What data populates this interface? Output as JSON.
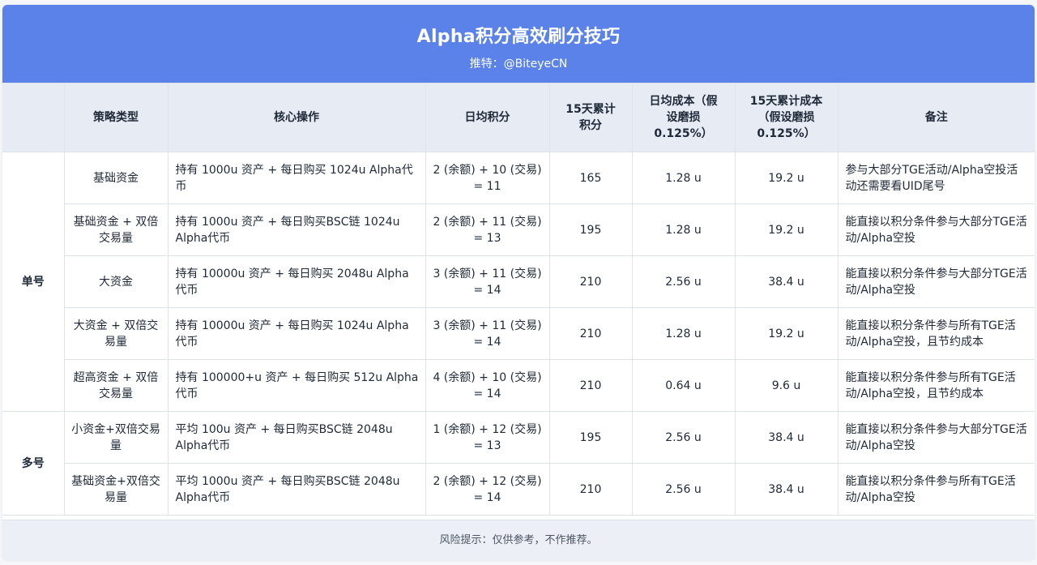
{
  "header": {
    "title": "Alpha积分高效刷分技巧",
    "subtitle": "推特：@BiteyeCN"
  },
  "table": {
    "columns": [
      "",
      "策略类型",
      "核心操作",
      "日均积分",
      "15天累计积分",
      "日均成本（假设磨损0.125%）",
      "15天累计成本（假设磨损0.125%）",
      "备注"
    ],
    "groups": [
      {
        "label": "单号",
        "rows": [
          {
            "strategy": "基础资金",
            "operation": "持有 1000u 资产 + 每日购买 1024u Alpha代币",
            "daily_points": "2 (余额) + 10 (交易) = 11",
            "total_points": "165",
            "daily_cost": "1.28 u",
            "total_cost": "19.2 u",
            "note": "参与大部分TGE活动/Alpha空投活动还需要看UID尾号"
          },
          {
            "strategy": "基础资金 + 双倍交易量",
            "operation": "持有 1000u 资产 + 每日购买BSC链 1024u Alpha代币",
            "daily_points": "2 (余额) + 11 (交易) = 13",
            "total_points": "195",
            "daily_cost": "1.28 u",
            "total_cost": "19.2 u",
            "note": "能直接以积分条件参与大部分TGE活动/Alpha空投"
          },
          {
            "strategy": "大资金",
            "operation": "持有 10000u 资产 + 每日购买 2048u Alpha代币",
            "daily_points": "3 (余额) + 11 (交易) = 14",
            "total_points": "210",
            "daily_cost": "2.56 u",
            "total_cost": "38.4 u",
            "note": "能直接以积分条件参与大部分TGE活动/Alpha空投"
          },
          {
            "strategy": "大资金 + 双倍交易量",
            "operation": "持有 10000u 资产 + 每日购买 1024u Alpha代币",
            "daily_points": "3 (余额) + 11 (交易) = 14",
            "total_points": "210",
            "daily_cost": "1.28 u",
            "total_cost": "19.2 u",
            "note": "能直接以积分条件参与所有TGE活动/Alpha空投，且节约成本"
          },
          {
            "strategy": "超高资金 + 双倍交易量",
            "operation": "持有 100000+u 资产 + 每日购买 512u Alpha代币",
            "daily_points": "4 (余额) + 10 (交易) = 14",
            "total_points": "210",
            "daily_cost": "0.64 u",
            "total_cost": "9.6 u",
            "note": "能直接以积分条件参与所有TGE活动/Alpha空投，且节约成本"
          }
        ]
      },
      {
        "label": "多号",
        "rows": [
          {
            "strategy": "小资金+双倍交易量",
            "operation": "平均 100u 资产 + 每日购买BSC链 2048u Alpha代币",
            "daily_points": "1 (余额) + 12 (交易) = 13",
            "total_points": "195",
            "daily_cost": "2.56 u",
            "total_cost": "38.4 u",
            "note": "能直接以积分条件参与大部分TGE活动/Alpha空投"
          },
          {
            "strategy": "基础资金+双倍交易量",
            "operation": "平均 1000u 资产 + 每日购买BSC链 2048u Alpha代币",
            "daily_points": "2 (余额) + 12 (交易) = 14",
            "total_points": "210",
            "daily_cost": "2.56 u",
            "total_cost": "38.4 u",
            "note": "能直接以积分条件参与所有TGE活动/Alpha空投"
          }
        ]
      }
    ]
  },
  "footer": {
    "text": "风险提示：仅供参考，不作推荐。"
  }
}
